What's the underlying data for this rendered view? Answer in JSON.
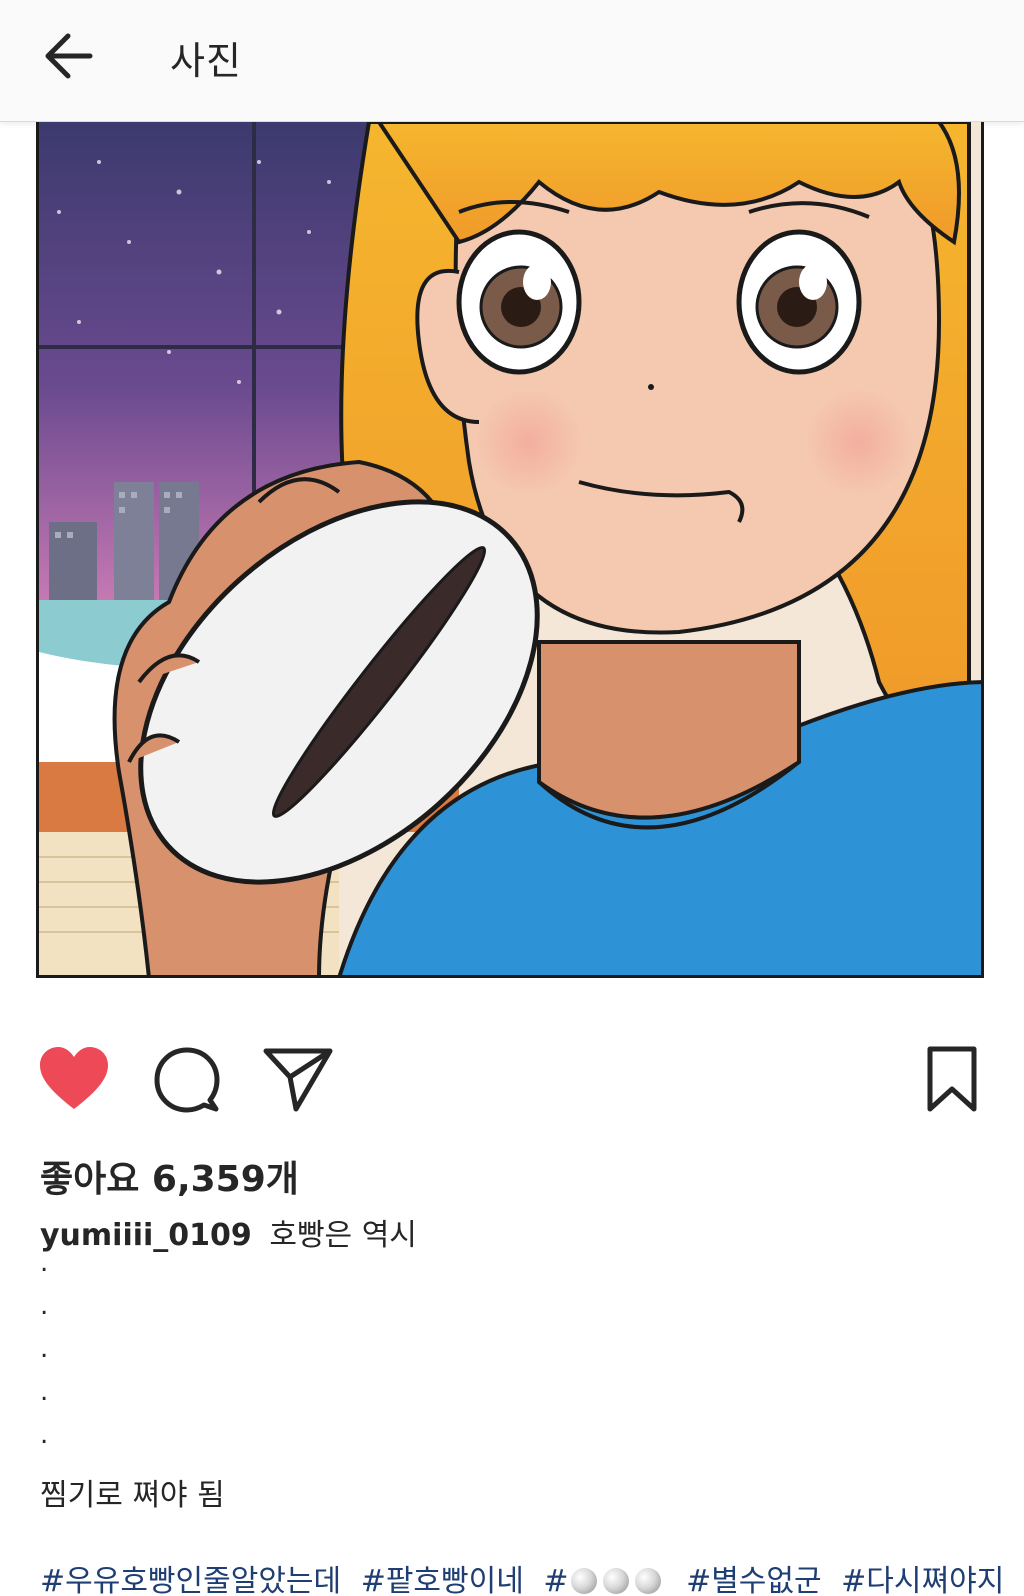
{
  "header": {
    "title": "사진",
    "back_icon": "arrow-left-icon"
  },
  "post": {
    "image_alt": "comic illustration of a girl eating a red bean bun",
    "likes_text": "좋아요 6,359개",
    "username": "yumiiii_0109",
    "caption_first": "호빵은 역시",
    "dots": [
      ".",
      ".",
      ".",
      ".",
      "."
    ],
    "caption_body": "찜기로 쪄야 됨",
    "hashtags": [
      "#우유호빵인줄알았는데",
      "#팥호빵이네",
      "#",
      "#별수없군",
      "#다시쪄야지"
    ],
    "emoji_after_hash": [
      "white-ball",
      "white-ball",
      "white-ball"
    ]
  },
  "actions": {
    "like_icon": "heart-icon",
    "like_color": "#ed4956",
    "comment_icon": "comment-icon",
    "share_icon": "send-icon",
    "save_icon": "bookmark-icon"
  },
  "colors": {
    "hashtag": "#1f3e73",
    "header_bg": "#fafafa"
  }
}
